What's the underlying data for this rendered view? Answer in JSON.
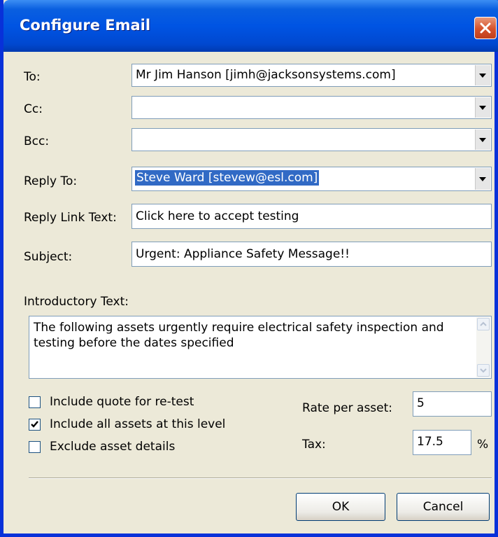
{
  "window": {
    "title": "Configure Email"
  },
  "fields": {
    "to": {
      "label": "To:",
      "value": "Mr Jim Hanson [jimh@jacksonsystems.com]"
    },
    "cc": {
      "label": "Cc:",
      "value": ""
    },
    "bcc": {
      "label": "Bcc:",
      "value": ""
    },
    "reply_to": {
      "label": "Reply To:",
      "value": "Steve Ward [stevew@esl.com]"
    },
    "reply_link_text": {
      "label": "Reply Link Text:",
      "value": "Click here to accept testing"
    },
    "subject": {
      "label": "Subject:",
      "value": "Urgent: Appliance Safety Message!!"
    }
  },
  "intro": {
    "label": "Introductory Text:",
    "text": "The following assets urgently require electrical safety inspection and testing before the dates specified"
  },
  "options": {
    "include_quote": {
      "label": "Include quote for re-test",
      "checked": false
    },
    "include_all": {
      "label": "Include all assets at this level",
      "checked": true
    },
    "exclude_details": {
      "label": "Exclude asset details",
      "checked": false
    }
  },
  "rate": {
    "label": "Rate per asset:",
    "value": "5"
  },
  "tax": {
    "label": "Tax:",
    "value": "17.5",
    "unit": "%"
  },
  "buttons": {
    "ok": "OK",
    "cancel": "Cancel"
  },
  "icons": {
    "close": "close-icon",
    "dropdown": "chevron-down-icon",
    "check": "check-icon"
  },
  "colors": {
    "titlebar": "#0054e3",
    "dialog_bg": "#ece9d8",
    "selection": "#316ac5",
    "close_button": "#d6512a"
  }
}
